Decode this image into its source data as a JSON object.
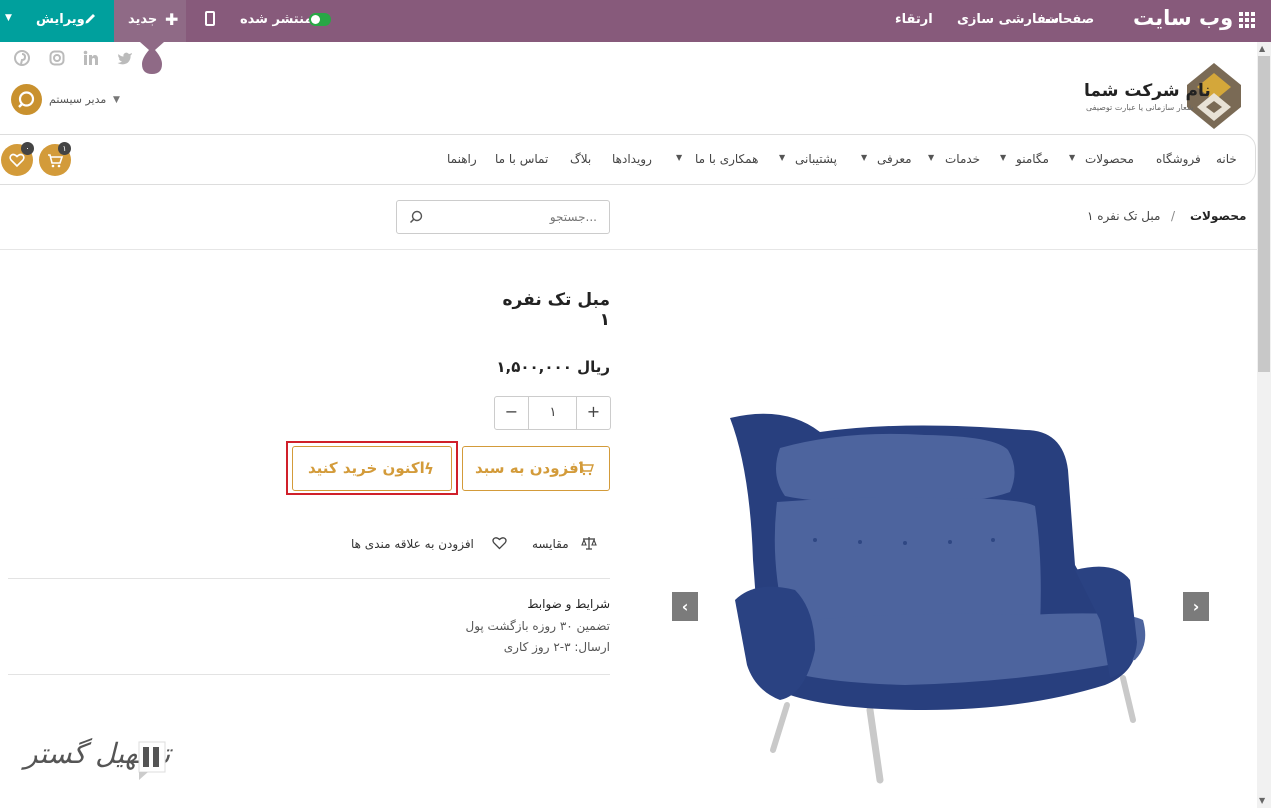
{
  "topbar": {
    "edit_label": "ویرایش",
    "new_label": "جدید",
    "published_label": "منتشر شده",
    "menu": [
      "ارتقاء",
      "سفارشی سازی",
      "صفحات"
    ],
    "site_title": "وب سایت",
    "colors": {
      "bar": "#875a7b",
      "edit": "#00a09d",
      "toggle": "#28a745"
    }
  },
  "social": [
    "pinterest-icon",
    "instagram-icon",
    "linkedin-icon",
    "twitter-icon"
  ],
  "header": {
    "company_name": "نام شرکت شما",
    "company_tagline": "شعار سازمانی یا عبارت توصیفی",
    "user_name": "مدیر سیستم"
  },
  "nav": {
    "items": [
      "خانه",
      "فروشگاه",
      "محصولات",
      "مگامنو",
      "خدمات",
      "معرفی",
      "پشتیبانی",
      "همکاری با ما",
      "رویدادها",
      "بلاگ",
      "تماس با ما",
      "راهنما"
    ],
    "cart_count": "۱",
    "wishlist_count": "۰",
    "accent": "#d39b3a"
  },
  "breadcrumb": {
    "root": "محصولات",
    "separator": "/",
    "current": "مبل تک نفره ۱"
  },
  "search": {
    "placeholder": "جستجو..."
  },
  "product": {
    "title": "مبل تک نفره ۱",
    "price": "۱,۵۰۰,۰۰۰ ریال",
    "quantity": "۱",
    "qty_minus": "−",
    "qty_plus": "+",
    "add_to_cart": "افزودن به سبد",
    "buy_now": "اکنون خرید کنید",
    "compare": "مقایسه",
    "wishlist": "افزودن به علاقه مندی ها",
    "terms": [
      "شرایط و ضوابط",
      "تضمین ۳۰ روزه بازگشت پول",
      "ارسال: ۳-۲ روز کاری"
    ]
  },
  "carousel": {
    "prev": "‹",
    "next": "›"
  },
  "watermark": {
    "text": "تسهیل گستر"
  }
}
